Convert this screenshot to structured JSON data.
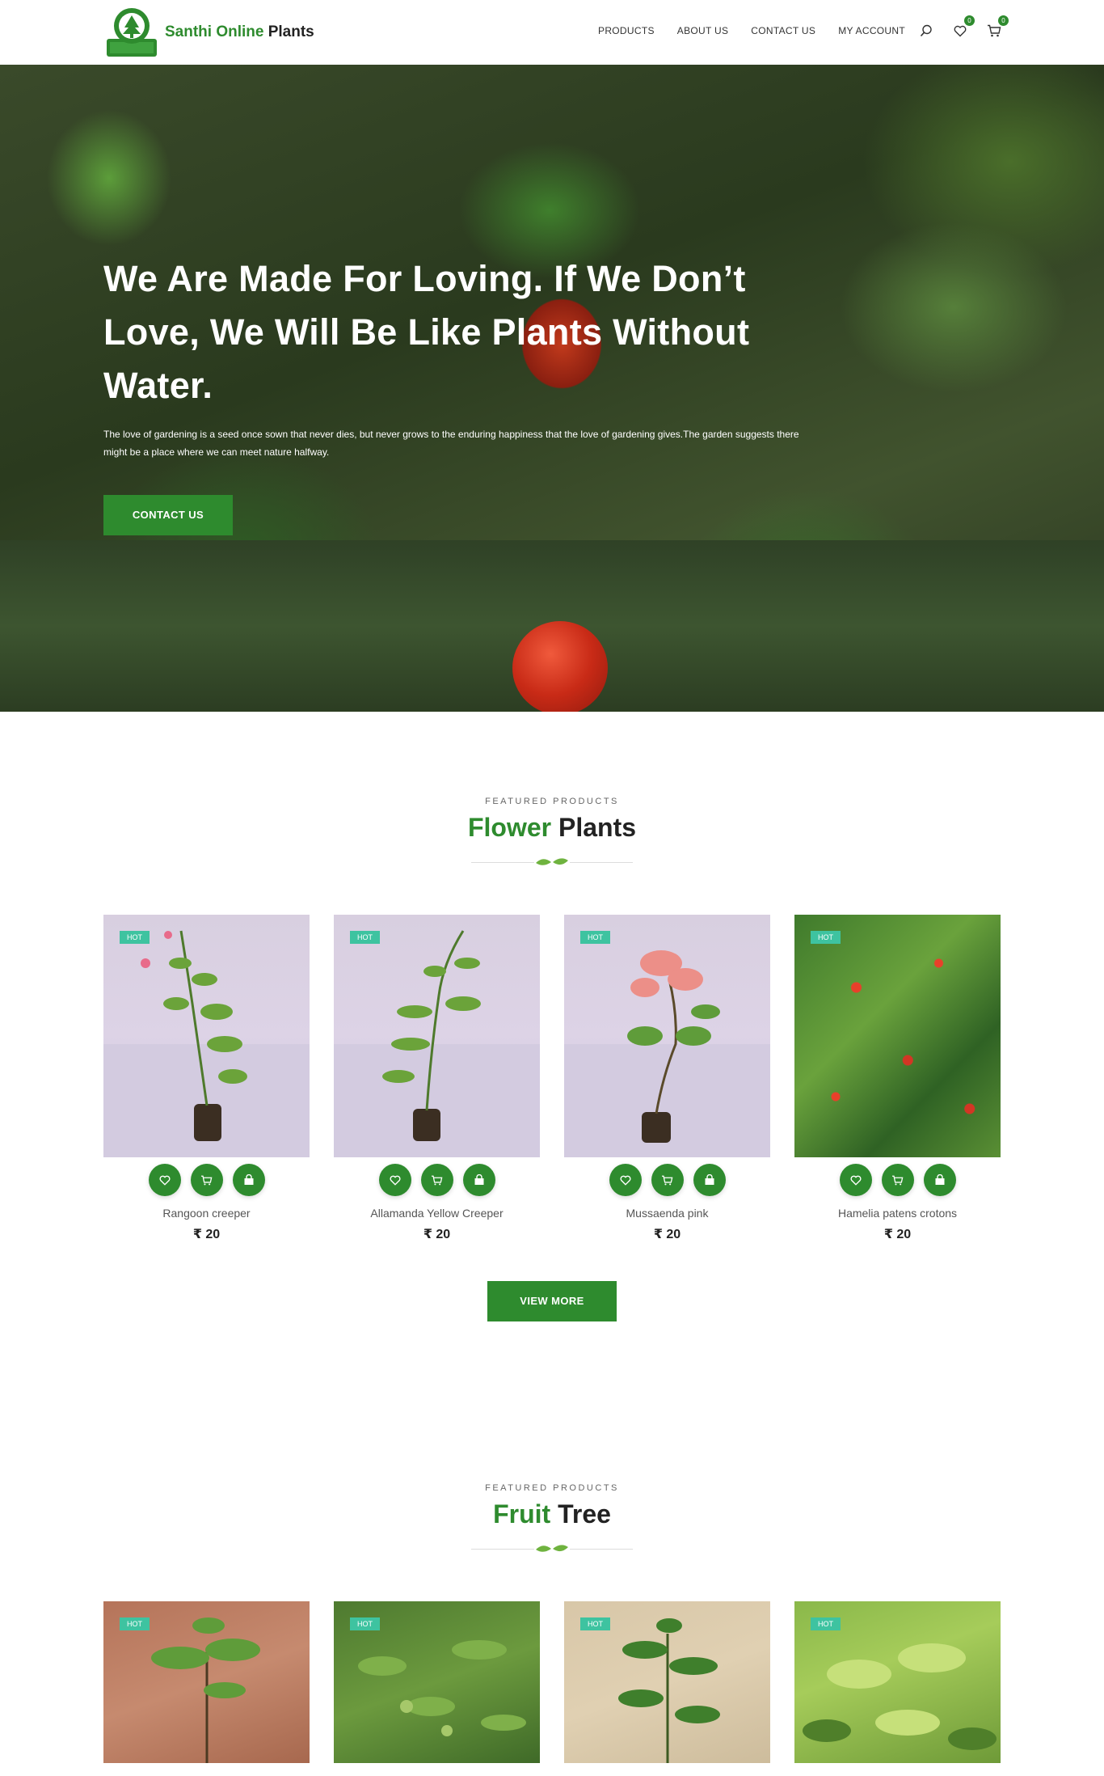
{
  "brand": {
    "name_green": "Santhi Online",
    "name_dark": "Plants"
  },
  "nav": [
    "PRODUCTS",
    "ABOUT US",
    "CONTACT US",
    "MY ACCOUNT"
  ],
  "header_icons": {
    "search": "search-icon",
    "wishlist": "heart-icon",
    "wishlist_count": "0",
    "cart": "cart-icon",
    "cart_count": "0"
  },
  "hero": {
    "title": "We Are Made For Loving. If We Don’t Love, We Will Be Like Plants Without Water.",
    "text": "The love of gardening is a seed once sown that never dies, but never grows to the enduring happiness that the love of gardening gives.The garden suggests there might be a place where we can meet nature halfway.",
    "button": "CONTACT US"
  },
  "flower_section": {
    "subtitle": "FEATURED PRODUCTS",
    "title_green": "Flower",
    "title_dark": "Plants",
    "products": [
      {
        "tag": "HOT",
        "name": "Rangoon creeper",
        "price": "₹ 20"
      },
      {
        "tag": "HOT",
        "name": "Allamanda Yellow Creeper",
        "price": "₹ 20"
      },
      {
        "tag": "HOT",
        "name": "Mussaenda pink",
        "price": "₹ 20"
      },
      {
        "tag": "HOT",
        "name": "Hamelia patens crotons",
        "price": "₹ 20"
      }
    ],
    "view_more": "VIEW MORE"
  },
  "fruit_section": {
    "subtitle": "FEATURED PRODUCTS",
    "title_green": "Fruit",
    "title_dark": "Tree",
    "products": [
      {
        "tag": "HOT"
      },
      {
        "tag": "HOT"
      },
      {
        "tag": "HOT"
      },
      {
        "tag": "HOT"
      }
    ]
  },
  "colors": {
    "brand_green": "#2e8b2e",
    "hot_tag": "#3ec3a0"
  }
}
